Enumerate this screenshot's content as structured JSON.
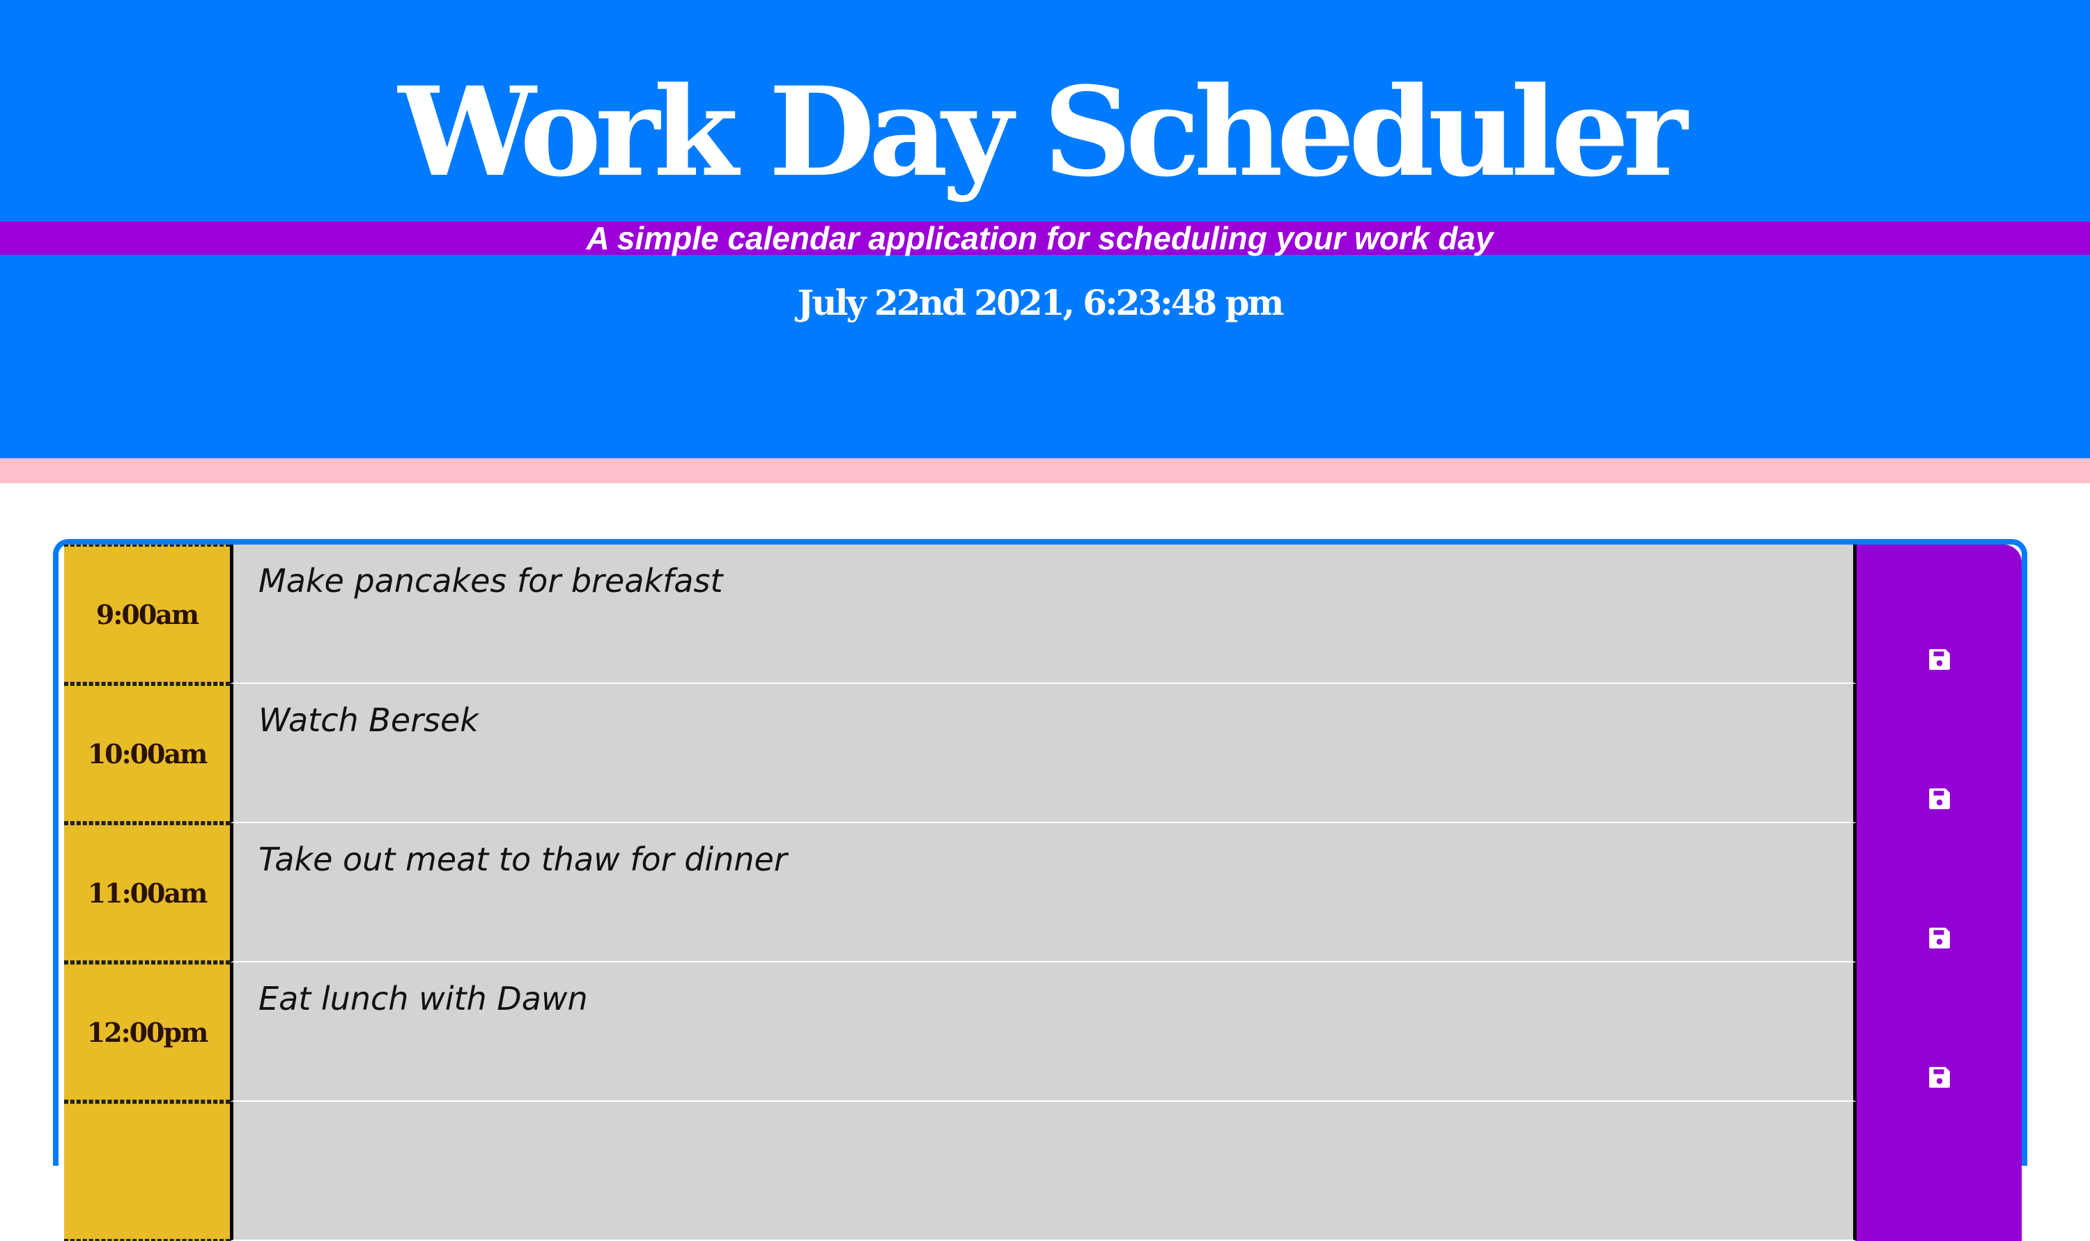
{
  "header": {
    "title": "Work Day Scheduler",
    "lead": "A simple calendar application for scheduling your work day",
    "current_day": "July 22nd 2021, 6:23:48 pm"
  },
  "colors": {
    "header_bg": "#007bff",
    "lead_band": "#9b00d9",
    "strip": "#ffc0cb",
    "hour_bg": "#e8bc27",
    "past_bg": "#d3d3d3",
    "save_bg": "#9400d3"
  },
  "schedule": {
    "rows": [
      {
        "hour": "9:00am",
        "text": "Make pancakes for breakfast",
        "save_icon": "save-icon"
      },
      {
        "hour": "10:00am",
        "text": "Watch Bersek",
        "save_icon": "save-icon"
      },
      {
        "hour": "11:00am",
        "text": "Take out meat to thaw for dinner",
        "save_icon": "save-icon"
      },
      {
        "hour": "12:00pm",
        "text": "Eat lunch with Dawn",
        "save_icon": "save-icon"
      },
      {
        "hour": "",
        "text": "",
        "save_icon": "save-icon"
      }
    ]
  }
}
